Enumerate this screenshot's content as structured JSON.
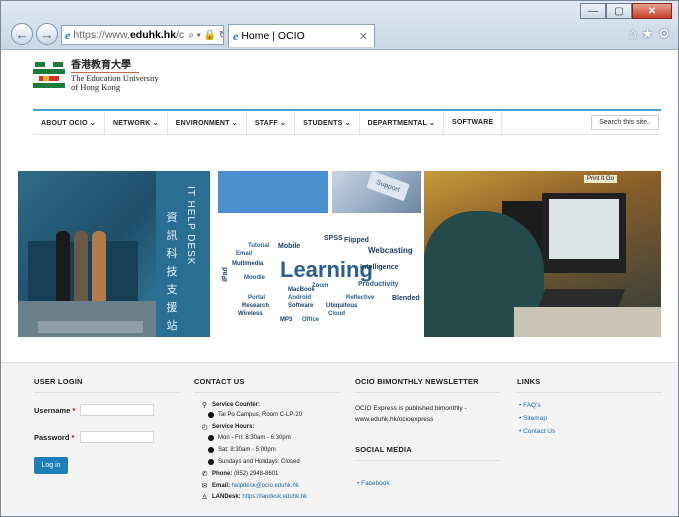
{
  "browser": {
    "address": {
      "scheme": "https://www.",
      "domain": "eduhk.hk",
      "rest": "/c",
      "controls": "⌕ ▾ 🔒 ↻"
    },
    "tab_title": "Home | OCIO",
    "tab_close": "✕",
    "back_glyph": "←",
    "forward_glyph": "→",
    "window_buttons": {
      "minimize": "—",
      "maximize": "▢",
      "close": "✕"
    },
    "toolbar_icons": {
      "home": "⌂",
      "favorites": "★",
      "settings": "⚙"
    }
  },
  "site": {
    "logo": {
      "zh": "香港教育大學",
      "en_line1": "The Education University",
      "en_line2": "of Hong Kong",
      "colors": {
        "green": "#1c7d3a",
        "red": "#d3342b",
        "yellow": "#f0b020"
      }
    },
    "menu": [
      {
        "label": "ABOUT OCIO ⌄"
      },
      {
        "label": "NETWORK ⌄"
      },
      {
        "label": "ENVIRONMENT ⌄"
      },
      {
        "label": "STAFF ⌄"
      },
      {
        "label": "STUDENTS ⌄"
      },
      {
        "label": "DEPARTMENTAL ⌄"
      },
      {
        "label": "SOFTWARE"
      }
    ],
    "search_placeholder": "Search this site..",
    "banner": {
      "help_desk_en": "IT HELP DESK",
      "help_desk_zh": "資訊科技支援站",
      "support_key": "Support",
      "word_cloud": {
        "center": "Learning",
        "words": [
          "Webcasting",
          "Intelligence",
          "Productivity",
          "Blended",
          "Reflective",
          "iPad",
          "Email",
          "Wireless",
          "MacBook",
          "Android",
          "Software",
          "SPSS",
          "Moodle",
          "Mobile",
          "Cloud",
          "MP3",
          "Office",
          "Multimedia",
          "Portal",
          "Research",
          "Zoom",
          "Flipped",
          "Ubiquitous",
          "Tutorial"
        ]
      },
      "print_sign": "Print It Go"
    }
  },
  "footer": {
    "user_login": {
      "heading": "USER LOGIN",
      "username_label": "Username",
      "password_label": "Password",
      "required": "*",
      "login_button": "Log in"
    },
    "contact": {
      "heading": "CONTACT US",
      "service_counter": "Service Counter:",
      "location": "Tai Po Campus, Room C-LP-20",
      "service_hours": "Service Hours:",
      "hours_weekday": "Mon - Fri: 8:30am - 6:30pm",
      "hours_sat": "Sat: 8:30am - 5:00pm",
      "hours_holiday": "Sundays and Holidays: Closed",
      "phone_label": "Phone:",
      "phone": "(852) 2948-8601",
      "email_label": "Email:",
      "email": "helpdesk@ocio.eduhk.hk",
      "landesk_label": "LANDesk:",
      "landesk": "https://landesk.eduhk.hk"
    },
    "newsletter": {
      "heading": "OCIO BIMONTHLY NEWSLETTER",
      "text": "OCIO Express is published bimonthly -",
      "link": "www.eduhk.hk/ocioexpress"
    },
    "social": {
      "heading": "SOCIAL MEDIA",
      "items": [
        "Facebook"
      ]
    },
    "links": {
      "heading": "LINKS",
      "items": [
        "FAQ's",
        "Sitemap",
        "Contact Us"
      ]
    }
  }
}
